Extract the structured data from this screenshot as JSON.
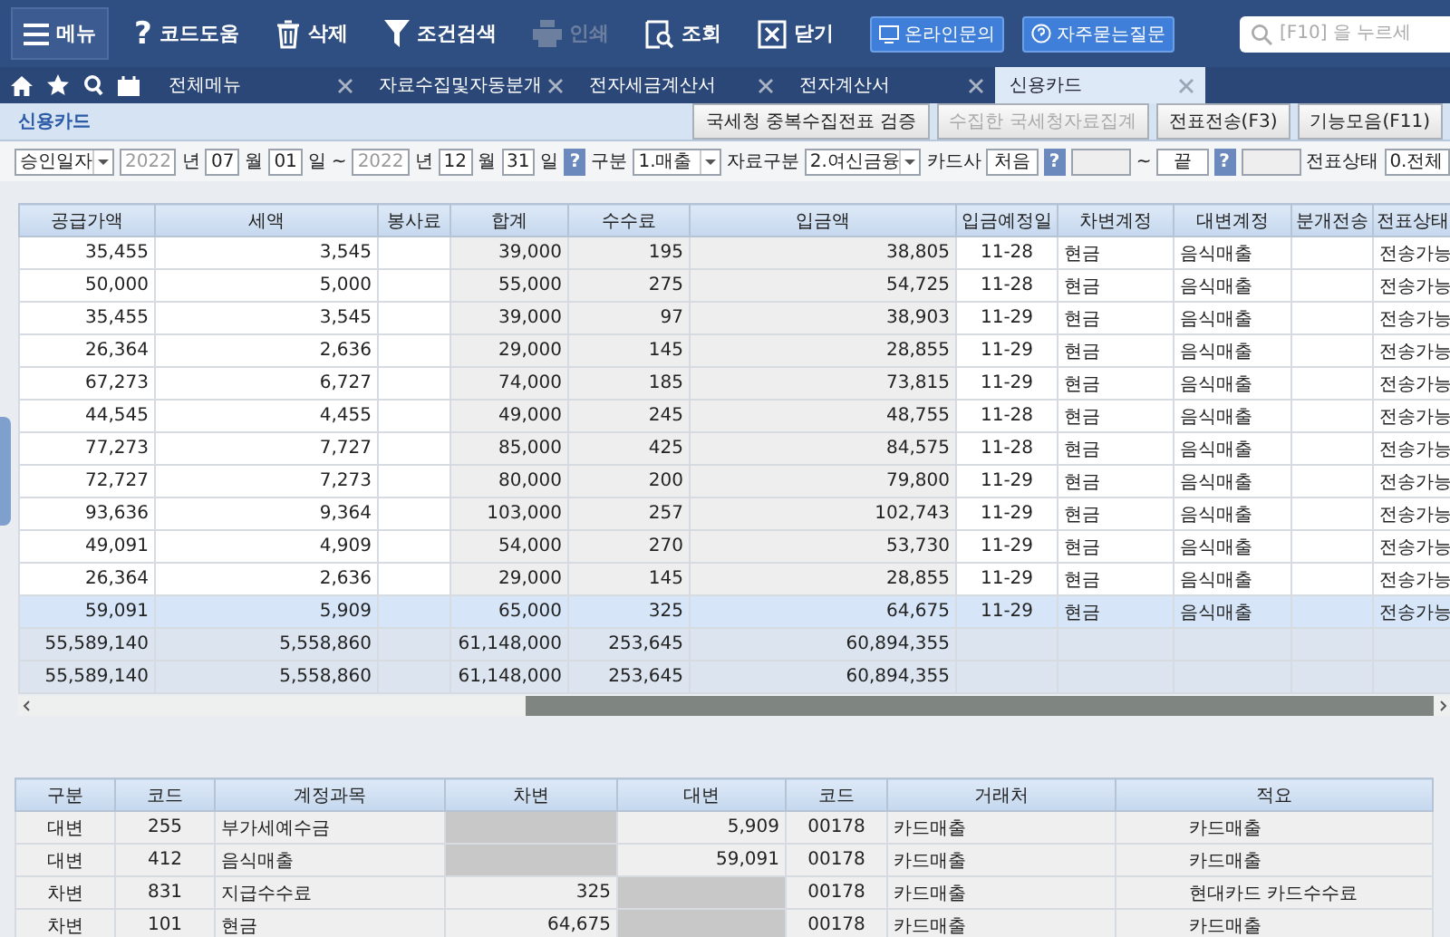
{
  "toolbar": {
    "items": [
      {
        "kind": "menu",
        "label": "메뉴",
        "disabled": false
      },
      {
        "kind": "help",
        "icon": "?",
        "label": "코드도움",
        "disabled": false
      },
      {
        "kind": "delete",
        "label": "삭제",
        "disabled": false
      },
      {
        "kind": "filter",
        "label": "조건검색",
        "disabled": false
      },
      {
        "kind": "print",
        "label": "인쇄",
        "disabled": true
      },
      {
        "kind": "lookup",
        "label": "조회",
        "disabled": false
      },
      {
        "kind": "close",
        "label": "닫기",
        "disabled": false
      }
    ],
    "links": [
      {
        "kind": "monitor",
        "label": "온라인문의"
      },
      {
        "kind": "question",
        "label": "자주묻는질문"
      }
    ],
    "search": {
      "placeholder": "[F10] 을 누르세"
    }
  },
  "tabs": [
    {
      "label": "전체메뉴",
      "selected": false
    },
    {
      "label": "자료수집및자동분개",
      "selected": false
    },
    {
      "label": "전자세금계산서",
      "selected": false
    },
    {
      "label": "전자계산서",
      "selected": false
    },
    {
      "label": "신용카드",
      "selected": true
    }
  ],
  "page": {
    "title": "신용카드",
    "buttons": [
      {
        "label": "국세청 중복수집전표 검증",
        "disabled": false
      },
      {
        "label": "수집한 국세청자료집계",
        "disabled": true
      },
      {
        "label": "전표전송(F3)",
        "disabled": false
      },
      {
        "label": "기능모음(F11)",
        "disabled": false
      }
    ]
  },
  "filters": {
    "date_type": "승인일자",
    "from_year": "2022",
    "from_year_label": "년",
    "from_month": "07",
    "from_month_label": "월",
    "from_day": "01",
    "from_day_label": "일",
    "range_sep": "~",
    "to_year": "2022",
    "to_year_label": "년",
    "to_month": "12",
    "to_month_label": "월",
    "to_day": "31",
    "to_day_label": "일",
    "help": "?",
    "type_label": "구분",
    "type_value": "1.매출",
    "source_label": "자료구분",
    "source_value": "2.여신금융",
    "card_label": "카드사",
    "card_from": "처음",
    "card_help": "?",
    "card_sep": "~",
    "card_to": "끝",
    "card_help2": "?",
    "status_label": "전표상태",
    "status_value": "0.전체"
  },
  "table": {
    "columns": [
      "공급가액",
      "세액",
      "봉사료",
      "합계",
      "수수료",
      "입금액",
      "입금예정일",
      "차변계정",
      "대변계정",
      "분개전송",
      "전표상태"
    ],
    "rows": [
      {
        "selected": false,
        "cells": [
          "35,455",
          "3,545",
          "",
          "39,000",
          "195",
          "38,805",
          "11-28",
          "현금",
          "음식매출",
          "",
          "전송가능"
        ]
      },
      {
        "selected": false,
        "cells": [
          "50,000",
          "5,000",
          "",
          "55,000",
          "275",
          "54,725",
          "11-28",
          "현금",
          "음식매출",
          "",
          "전송가능"
        ]
      },
      {
        "selected": false,
        "cells": [
          "35,455",
          "3,545",
          "",
          "39,000",
          "97",
          "38,903",
          "11-29",
          "현금",
          "음식매출",
          "",
          "전송가능"
        ]
      },
      {
        "selected": false,
        "cells": [
          "26,364",
          "2,636",
          "",
          "29,000",
          "145",
          "28,855",
          "11-29",
          "현금",
          "음식매출",
          "",
          "전송가능"
        ]
      },
      {
        "selected": false,
        "cells": [
          "67,273",
          "6,727",
          "",
          "74,000",
          "185",
          "73,815",
          "11-29",
          "현금",
          "음식매출",
          "",
          "전송가능"
        ]
      },
      {
        "selected": false,
        "cells": [
          "44,545",
          "4,455",
          "",
          "49,000",
          "245",
          "48,755",
          "11-28",
          "현금",
          "음식매출",
          "",
          "전송가능"
        ]
      },
      {
        "selected": false,
        "cells": [
          "77,273",
          "7,727",
          "",
          "85,000",
          "425",
          "84,575",
          "11-28",
          "현금",
          "음식매출",
          "",
          "전송가능"
        ]
      },
      {
        "selected": false,
        "cells": [
          "72,727",
          "7,273",
          "",
          "80,000",
          "200",
          "79,800",
          "11-29",
          "현금",
          "음식매출",
          "",
          "전송가능"
        ]
      },
      {
        "selected": false,
        "cells": [
          "93,636",
          "9,364",
          "",
          "103,000",
          "257",
          "102,743",
          "11-29",
          "현금",
          "음식매출",
          "",
          "전송가능"
        ]
      },
      {
        "selected": false,
        "cells": [
          "49,091",
          "4,909",
          "",
          "54,000",
          "270",
          "53,730",
          "11-29",
          "현금",
          "음식매출",
          "",
          "전송가능"
        ]
      },
      {
        "selected": false,
        "cells": [
          "26,364",
          "2,636",
          "",
          "29,000",
          "145",
          "28,855",
          "11-29",
          "현금",
          "음식매출",
          "",
          "전송가능"
        ]
      },
      {
        "selected": true,
        "cells": [
          "59,091",
          "5,909",
          "",
          "65,000",
          "325",
          "64,675",
          "11-29",
          "현금",
          "음식매출",
          "",
          "전송가능"
        ]
      }
    ],
    "totals": [
      {
        "supply_amount": "55,589,140",
        "tax": "5,558,860",
        "total": "61,148,000",
        "fee": "253,645",
        "deposit": "60,894,355"
      },
      {
        "supply_amount": "55,589,140",
        "tax": "5,558,860",
        "total": "61,148,000",
        "fee": "253,645",
        "deposit": "60,894,355"
      }
    ]
  },
  "journal": {
    "columns": [
      "구분",
      "코드",
      "계정과목",
      "차변",
      "대변",
      "코드",
      "거래처",
      "적요"
    ],
    "rows": [
      [
        "대변",
        "255",
        "부가세예수금",
        "",
        "5,909",
        "00178",
        "카드매출",
        "카드매출"
      ],
      [
        "대변",
        "412",
        "음식매출",
        "",
        "59,091",
        "00178",
        "카드매출",
        "카드매출"
      ],
      [
        "차변",
        "831",
        "지급수수료",
        "325",
        "",
        "00178",
        "카드매출",
        "현대카드 카드수수료"
      ],
      [
        "차변",
        "101",
        "현금",
        "64,675",
        "",
        "00178",
        "카드매출",
        "카드매출"
      ]
    ]
  }
}
